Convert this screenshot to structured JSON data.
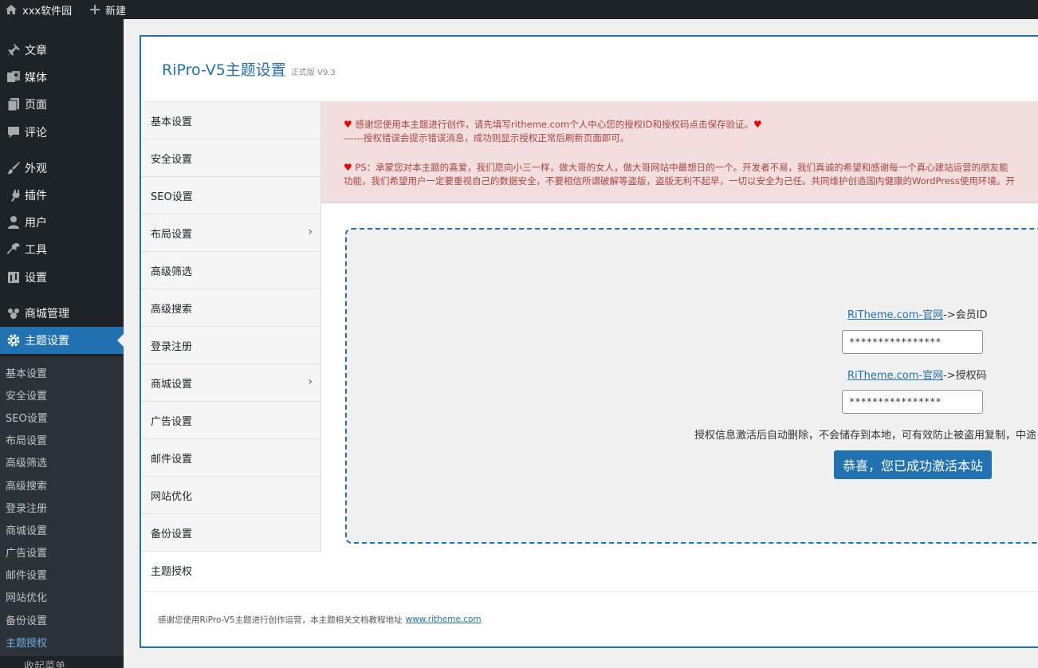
{
  "adminbar": {
    "site_name": "xxx软件园",
    "new_label": "新建"
  },
  "sidebar": {
    "items": [
      {
        "label": "文章",
        "icon": "pin-icon"
      },
      {
        "label": "媒体",
        "icon": "media-icon"
      },
      {
        "label": "页面",
        "icon": "page-icon"
      },
      {
        "label": "评论",
        "icon": "comment-icon"
      },
      {
        "label": "外观",
        "icon": "brush-icon"
      },
      {
        "label": "插件",
        "icon": "plugin-icon"
      },
      {
        "label": "用户",
        "icon": "user-icon"
      },
      {
        "label": "工具",
        "icon": "wrench-icon"
      },
      {
        "label": "设置",
        "icon": "settings-icon"
      },
      {
        "label": "商城管理",
        "icon": "shop-icon"
      },
      {
        "label": "主题设置",
        "icon": "gear-icon"
      }
    ],
    "submenu": [
      "基本设置",
      "安全设置",
      "SEO设置",
      "布局设置",
      "高级筛选",
      "高级搜索",
      "登录注册",
      "商城设置",
      "广告设置",
      "邮件设置",
      "网站优化",
      "备份设置",
      "主题授权"
    ],
    "bottom_label": "收起菜单"
  },
  "panel": {
    "title": "RiPro-V5主题设置",
    "version": "正式版 V9.3",
    "nav": [
      {
        "label": "基本设置",
        "has_children": false
      },
      {
        "label": "安全设置",
        "has_children": false
      },
      {
        "label": "SEO设置",
        "has_children": false
      },
      {
        "label": "布局设置",
        "has_children": true
      },
      {
        "label": "高级筛选",
        "has_children": false
      },
      {
        "label": "高级搜索",
        "has_children": false
      },
      {
        "label": "登录注册",
        "has_children": false
      },
      {
        "label": "商城设置",
        "has_children": true
      },
      {
        "label": "广告设置",
        "has_children": false
      },
      {
        "label": "邮件设置",
        "has_children": false
      },
      {
        "label": "网站优化",
        "has_children": false
      },
      {
        "label": "备份设置",
        "has_children": false
      },
      {
        "label": "主题授权",
        "has_children": false
      }
    ],
    "notice": {
      "line1": "感谢您使用本主题进行创作，请先填写ritheme.com个人中心您的授权ID和授权码点击保存验证。",
      "line2": "------授权错误会提示错误消息，成功则显示授权正常后刷新页面即可。",
      "line3": "PS：承蒙您对本主题的喜爱，我们愿向小三一样，做大哥的女人，做大哥网站中最想日的一个。开发者不易，我们真诚的希望和感谢每一个真心建站运营的朋友能",
      "line4": "功能，我们希望用户一定要重视自己的数据安全，不要相信所谓破解等盗版，盗版无利不起早，一切以安全为己任。共同维护创造国内健康的WordPress使用环境。开"
    },
    "auth": {
      "link_text": "RiTheme.com-官网",
      "id_suffix": "->会员ID",
      "id_value": "****************",
      "code_suffix": "->授权码",
      "code_value": "****************",
      "note": "授权信息激活后自动删除，不会储存到本地，可有效防止被盗用复制，中途",
      "button": "恭喜，您已成功激活本站"
    },
    "footer": {
      "text": "感谢您使用RiPro-V5主题进行创作运营，本主题相关文档教程地址",
      "link": "www.ritheme.com"
    }
  },
  "colors": {
    "accent": "#2271b1",
    "sidebar_bg": "#1d2327",
    "notice_bg": "#f2dede",
    "notice_text": "#a94442"
  }
}
